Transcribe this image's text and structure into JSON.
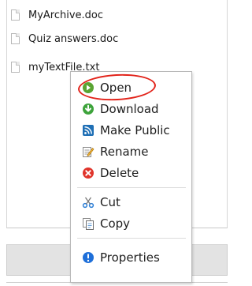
{
  "files": [
    {
      "name": "MyArchive.doc",
      "icon": "document-icon"
    },
    {
      "name": "Quiz answers.doc",
      "icon": "document-icon"
    },
    {
      "name": "myTextFile.txt",
      "icon": "document-icon",
      "selected": true
    }
  ],
  "context_menu": {
    "items": [
      {
        "label": "Open",
        "icon": "open-icon",
        "highlighted": true
      },
      {
        "label": "Download",
        "icon": "download-icon"
      },
      {
        "label": "Make Public",
        "icon": "make-public-icon"
      },
      {
        "label": "Rename",
        "icon": "rename-icon"
      },
      {
        "label": "Delete",
        "icon": "delete-icon"
      },
      {
        "label": "Cut",
        "icon": "cut-icon"
      },
      {
        "label": "Copy",
        "icon": "copy-icon"
      },
      {
        "label": "Properties",
        "icon": "properties-icon"
      }
    ]
  },
  "colors": {
    "highlight_ring": "#e2231a",
    "open_icon": "#5aa432",
    "download_icon": "#3da33b",
    "delete_icon": "#e0342b",
    "properties_icon": "#1e6fd9"
  }
}
